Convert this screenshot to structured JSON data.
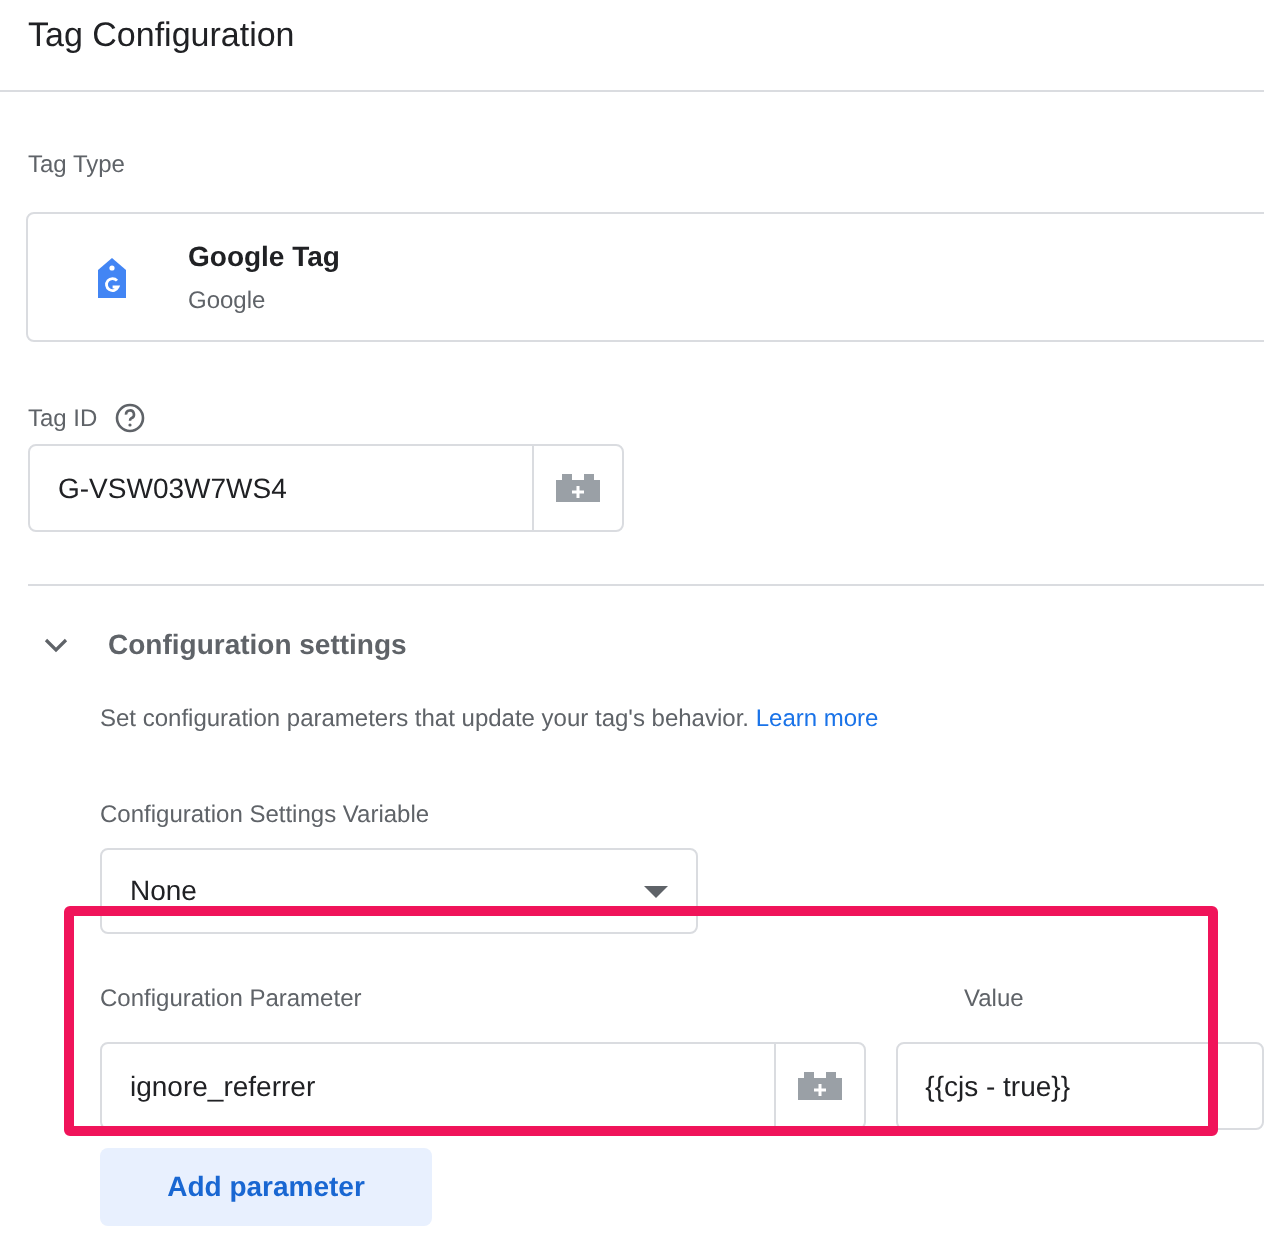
{
  "header": {
    "title": "Tag Configuration"
  },
  "tag_type": {
    "label": "Tag Type",
    "name": "Google Tag",
    "vendor": "Google"
  },
  "tag_id": {
    "label": "Tag ID",
    "value": "G-VSW03W7WS4"
  },
  "configuration_settings": {
    "title": "Configuration settings",
    "expanded": true,
    "description": "Set configuration parameters that update your tag's behavior.",
    "link": "Learn more",
    "variable": {
      "label": "Configuration Settings Variable",
      "value": "None"
    },
    "parameter_label": "Configuration Parameter",
    "value_label": "Value",
    "parameters": [
      {
        "name": "ignore_referrer",
        "value": "{{cjs - true}}"
      }
    ],
    "add_button": "Add parameter"
  }
}
